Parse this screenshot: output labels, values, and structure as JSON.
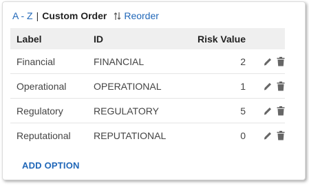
{
  "sort": {
    "az_label": "A - Z",
    "separator": "|",
    "custom_label": "Custom Order",
    "reorder_label": "Reorder"
  },
  "table": {
    "headers": {
      "label": "Label",
      "id": "ID",
      "risk": "Risk Value"
    },
    "rows": [
      {
        "label": "Financial",
        "id": "FINANCIAL",
        "risk": "2"
      },
      {
        "label": "Operational",
        "id": "OPERATIONAL",
        "risk": "1"
      },
      {
        "label": "Regulatory",
        "id": "REGULATORY",
        "risk": "5"
      },
      {
        "label": "Reputational",
        "id": "REPUTATIONAL",
        "risk": "0"
      }
    ]
  },
  "actions": {
    "add_option": "ADD OPTION"
  },
  "colors": {
    "link": "#2067b8",
    "header_bg": "#efefef",
    "icon": "#666666"
  },
  "icons": {
    "edit": "pencil-icon",
    "delete": "trash-icon",
    "reorder": "sort-arrows-icon"
  }
}
